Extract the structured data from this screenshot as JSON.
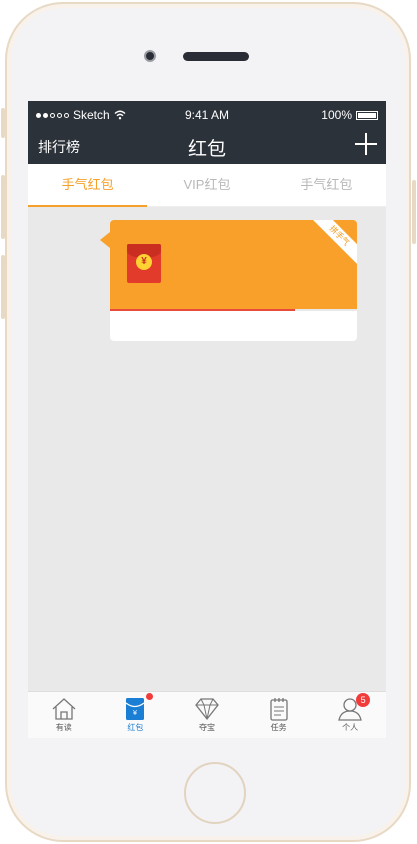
{
  "status": {
    "carrier": "Sketch",
    "time": "9:41 AM",
    "battery": "100%"
  },
  "nav": {
    "left_label": "排行榜",
    "title": "红包"
  },
  "tabs": [
    {
      "label": "手气红包",
      "active": true
    },
    {
      "label": "VIP红包",
      "active": false
    },
    {
      "label": "手气红包",
      "active": false
    }
  ],
  "card": {
    "coin_symbol": "¥",
    "ribbon_text": "拼手气",
    "progress_fraction": 0.75,
    "accent_color": "#f9a02b"
  },
  "tabbar": [
    {
      "label": "有读",
      "icon": "home-icon"
    },
    {
      "label": "红包",
      "icon": "red-packet-icon",
      "active": true,
      "dot": true
    },
    {
      "label": "夺宝",
      "icon": "diamond-icon"
    },
    {
      "label": "任务",
      "icon": "task-icon"
    },
    {
      "label": "个人",
      "icon": "user-icon",
      "badge": "5"
    }
  ]
}
